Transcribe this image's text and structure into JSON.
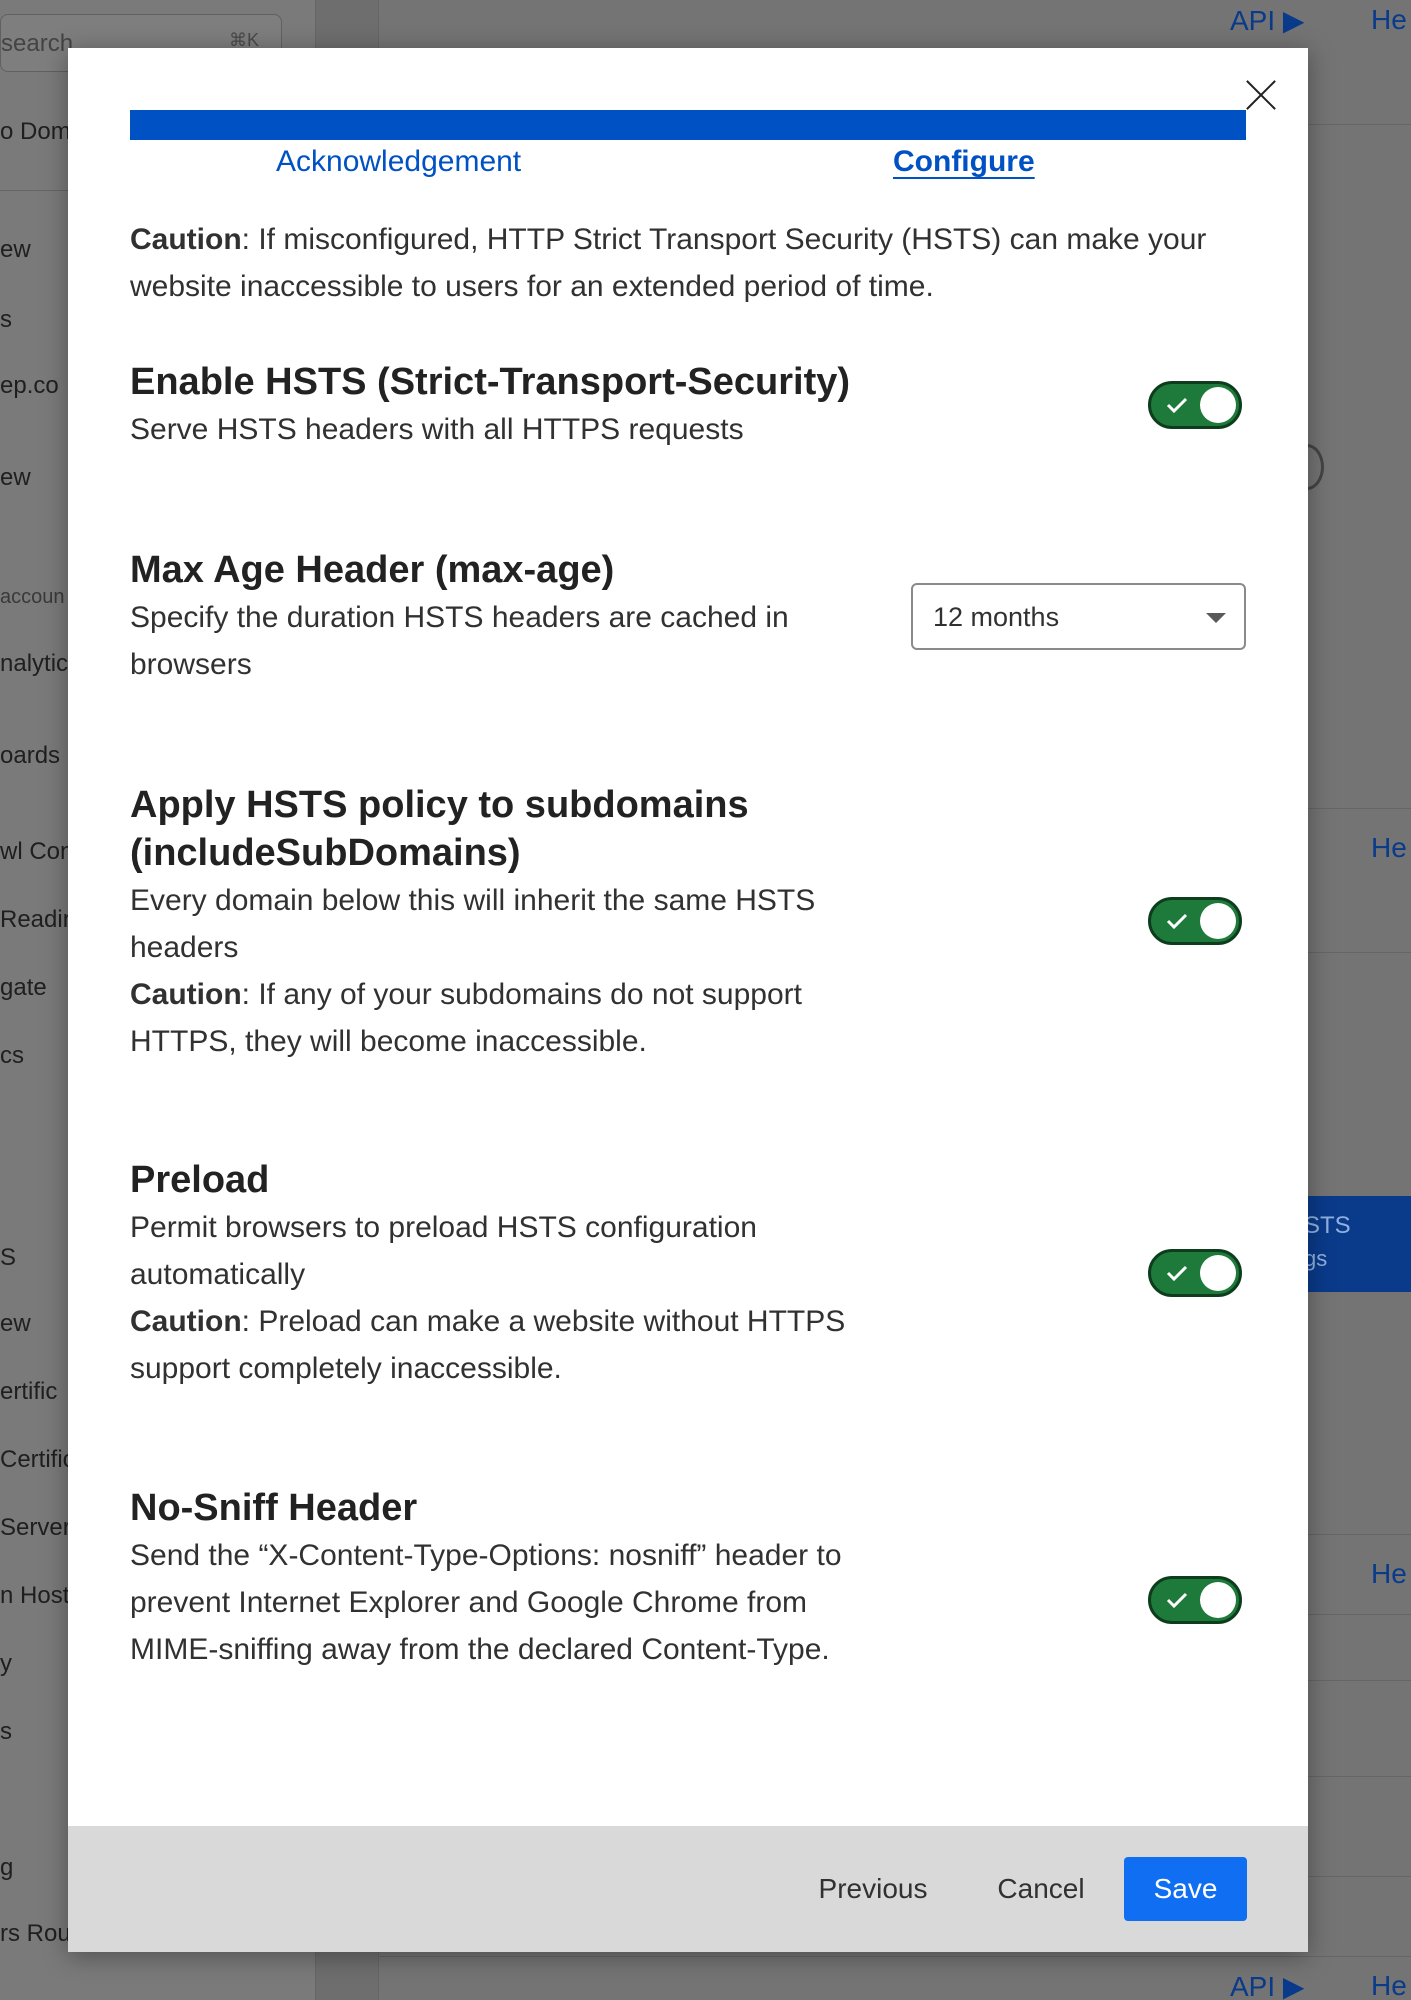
{
  "background": {
    "search_placeholder": "search",
    "search_shortcut": "⌘K",
    "sidebar_items": [
      "o Dom",
      "ew",
      "s",
      "ep.co",
      "ew",
      "accoun",
      "nalytic",
      "oards",
      "wl Con",
      "Readin",
      "gate",
      "cs",
      "S",
      "ew",
      "ertific",
      "Certific",
      "Server",
      "n Host",
      "y",
      "s",
      "g",
      "rs Rou"
    ],
    "links": [
      "API ▶",
      "He",
      "He",
      "He",
      "API ▶",
      "He"
    ],
    "panel_text": [
      "STS",
      "gs"
    ]
  },
  "modal": {
    "steps": [
      {
        "label": "Acknowledgement",
        "active": false
      },
      {
        "label": "Configure",
        "active": true
      }
    ],
    "intro": {
      "caution_label": "Caution",
      "text": ": If misconfigured, HTTP Strict Transport Security (HSTS) can make your website inaccessible to users for an extended period of time."
    },
    "settings": {
      "hsts": {
        "title": "Enable HSTS (Strict-Transport-Security)",
        "description": "Serve HSTS headers with all HTTPS requests",
        "enabled": true
      },
      "max_age": {
        "title": "Max Age Header (max-age)",
        "description": "Specify the duration HSTS headers are cached in browsers",
        "selected": "12 months"
      },
      "subdomains": {
        "title": "Apply HSTS policy to subdomains (includeSubDomains)",
        "description": "Every domain below this will inherit the same HSTS headers",
        "caution_label": "Caution",
        "caution_text": ": If any of your subdomains do not support HTTPS, they will become inaccessible.",
        "enabled": true
      },
      "preload": {
        "title": "Preload",
        "description": "Permit browsers to preload HSTS configuration automatically",
        "caution_label": "Caution",
        "caution_text": ": Preload can make a website without HTTPS support completely inaccessible.",
        "enabled": true
      },
      "nosniff": {
        "title": "No-Sniff Header",
        "description": "Send the “X-Content-Type-Options: nosniff” header to prevent Internet Explorer and Google Chrome from MIME-sniffing away from the declared Content-Type.",
        "enabled": true
      }
    },
    "footer": {
      "previous_label": "Previous",
      "cancel_label": "Cancel",
      "save_label": "Save"
    }
  },
  "colors": {
    "accent": "#0051c3",
    "toggle_on": "#1e7a3a",
    "save_button": "#0f6ef2",
    "footer_bg": "#d9d9d9"
  }
}
